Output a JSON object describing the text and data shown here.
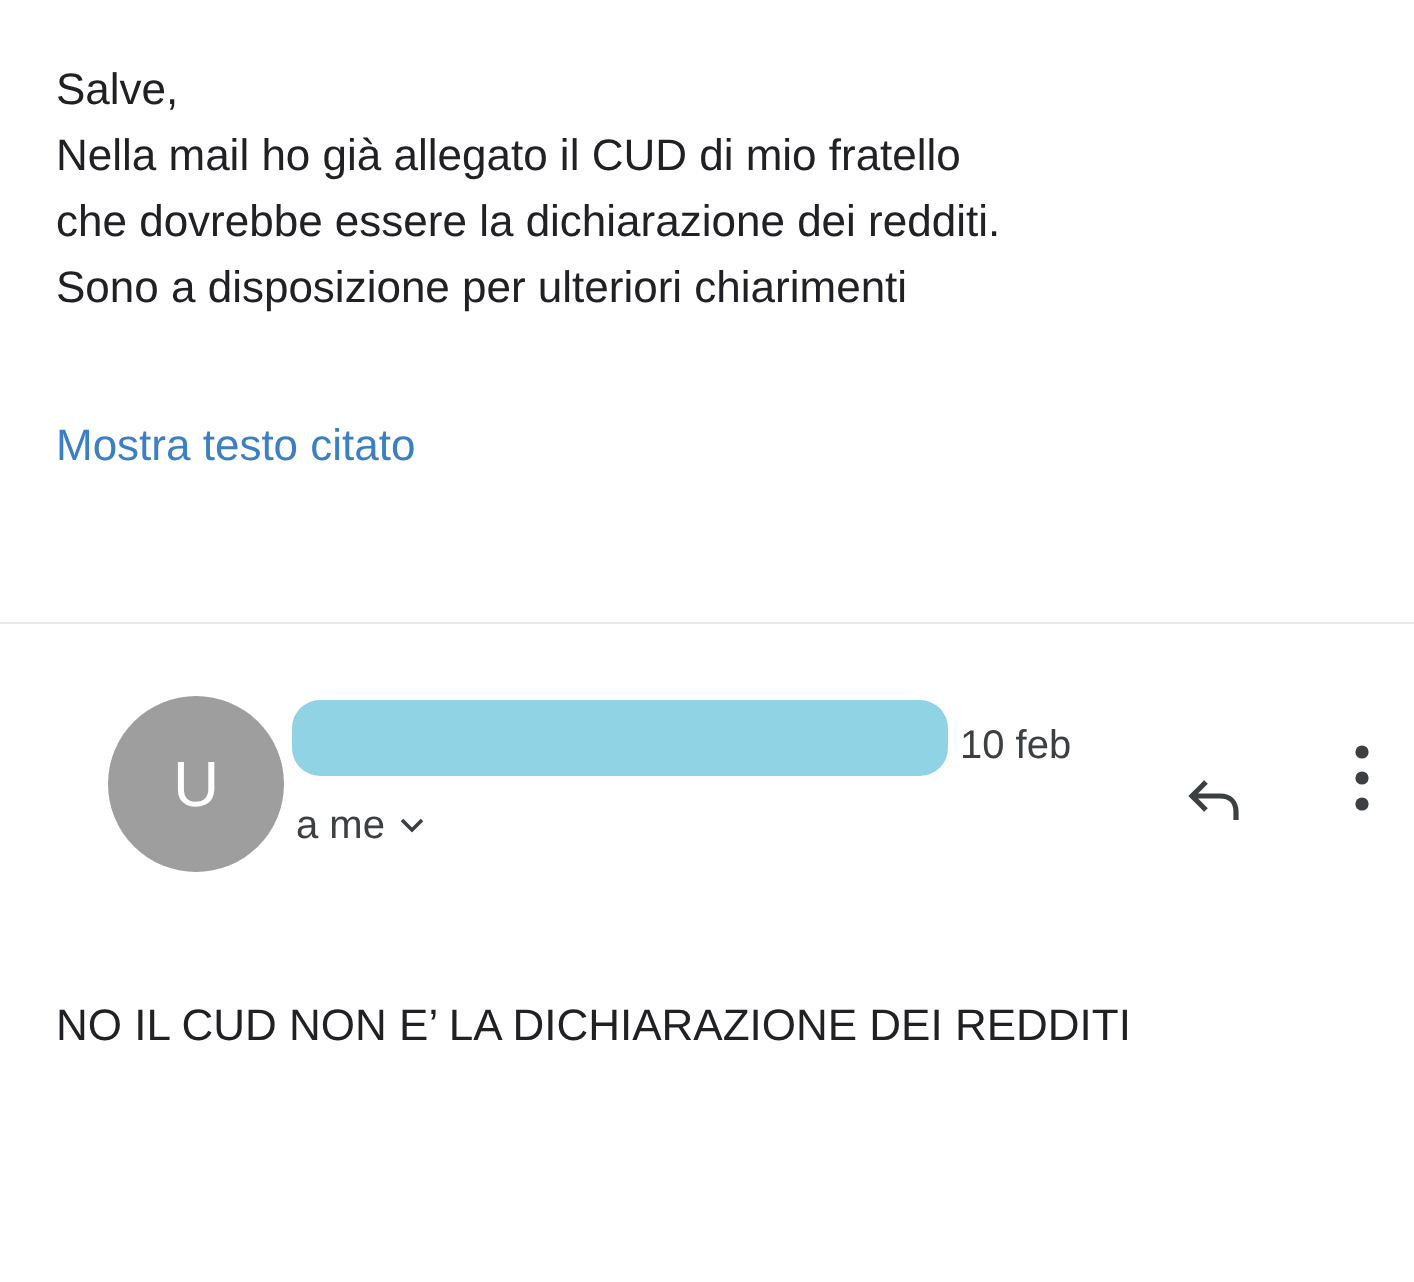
{
  "previous_message": {
    "lines": [
      "Salve,",
      "Nella mail ho già allegato il CUD di mio fratello",
      "che dovrebbe essere la dichiarazione dei redditi.",
      "Sono a disposizione per ulteriori chiarimenti"
    ],
    "show_quoted_link": "Mostra testo citato"
  },
  "message": {
    "avatar_letter": "U",
    "date": "10 feb",
    "recipient": "a me",
    "body": "NO IL CUD NON E’ LA DICHIARAZIONE DEI REDDITI"
  }
}
